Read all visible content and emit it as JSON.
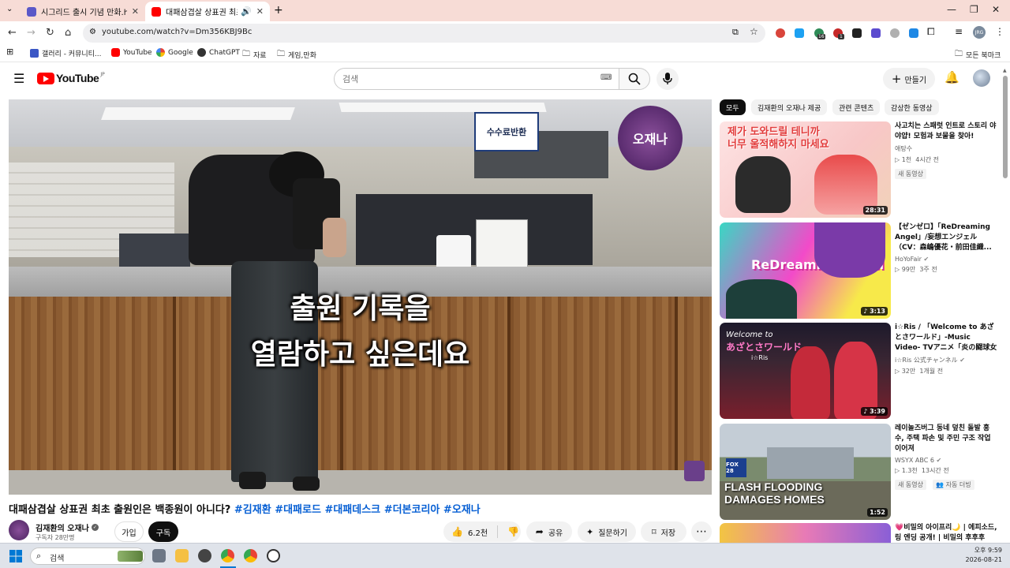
{
  "browser": {
    "tabs": [
      {
        "title": "시그리드 출시 기념 만화.horse",
        "active": false
      },
      {
        "title": "대패삼겹살 상표권 최초 출",
        "active": true
      }
    ],
    "url": "youtube.com/watch?v=Dm356KBJ9Bc",
    "bookmarks": [
      {
        "label": "갤러리 - 커뮤니티..."
      },
      {
        "label": "YouTube"
      },
      {
        "label": "Google"
      },
      {
        "label": "ChatGPT"
      },
      {
        "label": "자료"
      },
      {
        "label": "게임,만화"
      }
    ],
    "all_bookmarks": "모든 북마크",
    "ext_badge_1": "16",
    "ext_badge_2": "1",
    "profile": "JRG"
  },
  "youtube": {
    "logo": "YouTube",
    "region": "JP",
    "search_placeholder": "검색",
    "create_label": "만들기"
  },
  "video": {
    "title_main": "대패삼겹살 상표권 최초 출원인은 백종원이 아니다?",
    "tags": [
      "#김재환",
      "#대패로드",
      "#대패데스크",
      "#더본코리아",
      "#오재나"
    ],
    "sign_text": "수수료반환",
    "watermark": "오재나",
    "subtitle_line1": "출원 기록을",
    "subtitle_line2": "열람하고 싶은데요",
    "channel_name": "김재환의 오재나",
    "subscribers": "구독자 28만명",
    "join_label": "가입",
    "subscribe_label": "구독",
    "likes": "6.2천",
    "share_label": "공유",
    "ask_label": "질문하기",
    "save_label": "저장"
  },
  "sidebar": {
    "chips": [
      "모두",
      "김재환의 오재나 제공",
      "관련 콘텐츠",
      "감상한 동영상"
    ],
    "recommendations": [
      {
        "title": "사고치는 스패럿 인트로 스토리 야야얍! 모험과 보물을 찾아!",
        "channel": "애탕수",
        "views": "1천",
        "age": "4시간 전",
        "badge": "새 동영상",
        "duration": "28:31",
        "thumb_text_1": "제가 도와드릴 테니까",
        "thumb_text_2": "너무 울적해하지 마세요"
      },
      {
        "title": "【ゼンゼロ】「ReDreaming Angel」/妄想エンジェル（CV：森嶋優花・前田佳織...",
        "channel": "HoYoFair",
        "views": "99만",
        "age": "3주 전",
        "duration": "3:13",
        "thumb_text_1": "ReDreaming Angel"
      },
      {
        "title": "i☆Ris / 「Welcome to あざとさワールド」-Music Video- TVアニメ「炎の闘球女 ドッ...",
        "channel": "i☆Ris 公式チャンネル",
        "views": "32만",
        "age": "1개월 전",
        "duration": "3:39",
        "thumb_text_1": "Welcome to",
        "thumb_text_2": "あざとさワールド",
        "thumb_text_3": "i☆Ris"
      },
      {
        "title": "레이놀즈버그 동네 덮친 돌발 홍수, 주택 파손 및 주민 구조 작업 이어져",
        "channel": "WSYX ABC 6",
        "views": "1.3천",
        "age": "13시간 전",
        "badge": "새 동영상",
        "badge2": "자동 더빙",
        "duration": "1:52",
        "thumb_text_1": "FLASH FLOODING",
        "thumb_text_2": "DAMAGES HOMES",
        "thumb_text_3": "FOX 28"
      },
      {
        "title": "💗비밀의 아이프리🌙 | 에피소드,링 엔딩 공개! | 비밀의 후후후"
      }
    ]
  },
  "taskbar": {
    "search_placeholder": "검색",
    "time": "오후 9:59",
    "date": "2026-08-21"
  },
  "colors": {
    "tab_strip": "#f7dcd6",
    "youtube_red": "#ff0000",
    "link_blue": "#065fd4",
    "subscribe_black": "#0f0f0f"
  }
}
